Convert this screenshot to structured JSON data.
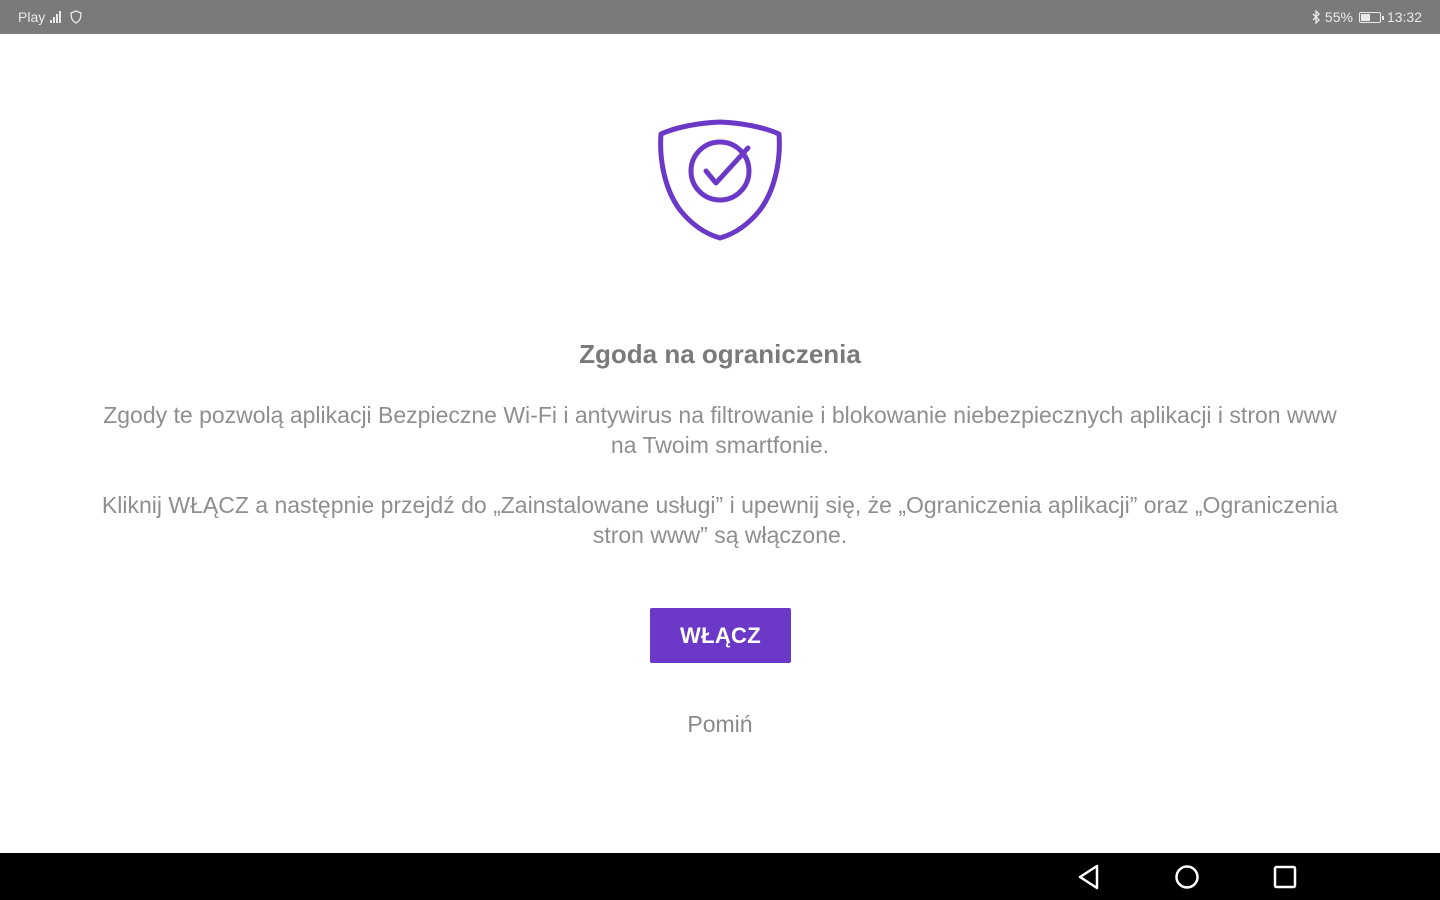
{
  "status_bar": {
    "carrier": "Play",
    "network_icon": "signal-icon",
    "shield_icon": "shield-status-icon",
    "bluetooth_icon": "bluetooth-icon",
    "battery_percent": "55%",
    "battery_level": 0.55,
    "time": "13:32"
  },
  "dialog": {
    "icon": "shield-check-icon",
    "accent_color": "#6c38c8",
    "title": "Zgoda na ograniczenia",
    "paragraph_1": "Zgody te pozwolą aplikacji Bezpieczne Wi-Fi i antywirus na filtrowanie i blokowanie niebezpiecznych aplikacji i stron www na Twoim smartfonie.",
    "paragraph_2": "Kliknij WŁĄCZ a następnie przejdź do „Zainstalowane usługi” i upewnij się, że „Ograniczenia aplikacji” oraz „Ograniczenia stron www” są włączone.",
    "enable_button": "WŁĄCZ",
    "skip_link": "Pomiń"
  },
  "nav_bar": {
    "back_icon": "back-triangle-icon",
    "home_icon": "home-circle-icon",
    "recent_icon": "recent-apps-square-icon"
  }
}
